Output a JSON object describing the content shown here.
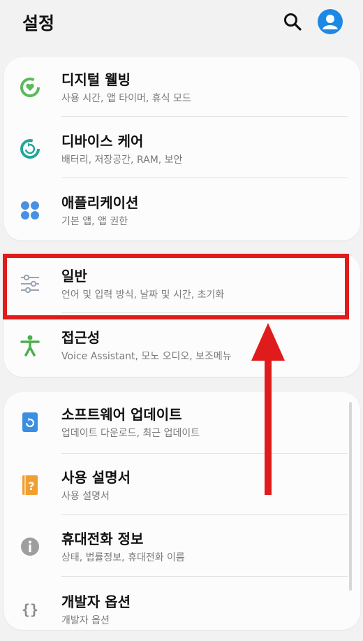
{
  "header": {
    "title": "설정"
  },
  "items": [
    {
      "title": "디지털 웰빙",
      "subtitle": "사용 시간, 앱 타이머, 휴식 모드",
      "icon": "digital-wellbeing-icon",
      "color": "#5cb85c"
    },
    {
      "title": "디바이스 케어",
      "subtitle": "배터리, 저장공간, RAM, 보안",
      "icon": "device-care-icon",
      "color": "#26a69a"
    },
    {
      "title": "애플리케이션",
      "subtitle": "기본 앱, 앱 권한",
      "icon": "apps-icon",
      "color": "#4a90e2"
    },
    {
      "title": "일반",
      "subtitle": "언어 및 입력 방식, 날짜 및 시간, 초기화",
      "icon": "sliders-icon",
      "color": "#9aa4b2"
    },
    {
      "title": "접근성",
      "subtitle": "Voice Assistant, 모노 오디오, 보조메뉴",
      "icon": "accessibility-icon",
      "color": "#4caf50"
    },
    {
      "title": "소프트웨어 업데이트",
      "subtitle": "업데이트 다운로드, 최근 업데이트",
      "icon": "software-update-icon",
      "color": "#3b8fe0"
    },
    {
      "title": "사용 설명서",
      "subtitle": "사용 설명서",
      "icon": "user-manual-icon",
      "color": "#f0a030"
    },
    {
      "title": "휴대전화 정보",
      "subtitle": "상태, 법률정보, 휴대전화 이름",
      "icon": "info-icon",
      "color": "#9e9e9e"
    },
    {
      "title": "개발자 옵션",
      "subtitle": "개발자 옵션",
      "icon": "developer-options-icon",
      "color": "#8a8a8a"
    }
  ],
  "annotation": {
    "highlight_color": "#e01b1b",
    "highlighted_item": "일반"
  },
  "colors": {
    "background": "#f2f2f2",
    "card": "#fcfcfc",
    "avatar": "#1e88e5"
  }
}
